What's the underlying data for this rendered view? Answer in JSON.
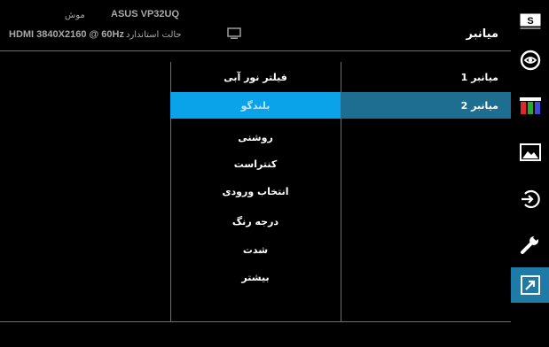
{
  "header": {
    "title": "میانبر",
    "model": "ASUS  VP32UQ",
    "mode": "موش",
    "input": "HDMI 3840X2160 @ 60Hz",
    "preset": "حالت استاندارد"
  },
  "rail": {
    "items": [
      {
        "icon": "splendid-icon",
        "glyph": "S"
      },
      {
        "icon": "eye-care-icon"
      },
      {
        "icon": "color-bars-icon"
      },
      {
        "icon": "image-icon"
      },
      {
        "icon": "input-select-icon"
      },
      {
        "icon": "wrench-icon"
      },
      {
        "icon": "shortcut-arrow-icon",
        "active": true
      }
    ],
    "active_color": "#1e7ba8"
  },
  "column1": {
    "items": [
      {
        "label": "میانبر 1"
      },
      {
        "label": "میانبر 2",
        "selected": true
      }
    ]
  },
  "column2": {
    "items": [
      {
        "label": "فیلتر نور آبی"
      },
      {
        "label": "بلندگو",
        "highlight": true
      },
      {
        "label": "روشنی"
      },
      {
        "label": "کنتراست"
      },
      {
        "label": "انتخاب ورودی"
      },
      {
        "label": "درجه رنگ"
      },
      {
        "label": "شدت"
      },
      {
        "label": "بیشتر"
      }
    ]
  },
  "colors": {
    "highlight": "#0aa2e8",
    "selected": "#1e6e91",
    "divider": "#6f6f6f"
  }
}
